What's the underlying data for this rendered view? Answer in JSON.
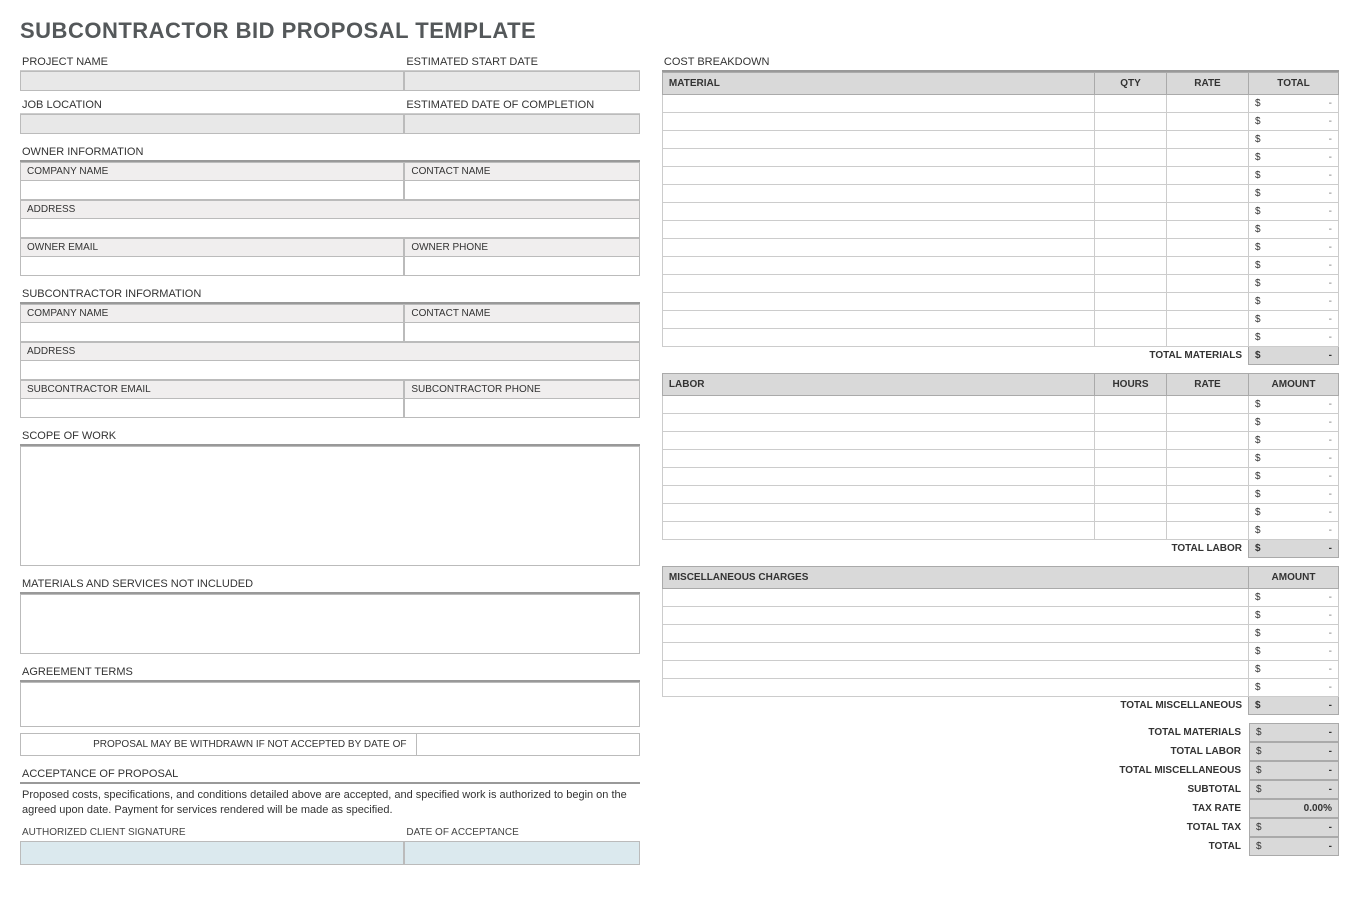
{
  "title": "SUBCONTRACTOR BID PROPOSAL TEMPLATE",
  "left": {
    "project": {
      "project_name_label": "PROJECT NAME",
      "estimated_start_label": "ESTIMATED START DATE",
      "job_location_label": "JOB LOCATION",
      "estimated_completion_label": "ESTIMATED DATE OF COMPLETION"
    },
    "owner": {
      "section": "OWNER INFORMATION",
      "company_label": "COMPANY NAME",
      "contact_label": "CONTACT NAME",
      "address_label": "ADDRESS",
      "email_label": "OWNER EMAIL",
      "phone_label": "OWNER PHONE"
    },
    "sub": {
      "section": "SUBCONTRACTOR INFORMATION",
      "company_label": "COMPANY NAME",
      "contact_label": "CONTACT NAME",
      "address_label": "ADDRESS",
      "email_label": "SUBCONTRACTOR EMAIL",
      "phone_label": "SUBCONTRACTOR PHONE"
    },
    "scope_label": "SCOPE OF WORK",
    "not_included_label": "MATERIALS AND SERVICES NOT INCLUDED",
    "agreement_label": "AGREEMENT TERMS",
    "withdraw_label": "PROPOSAL MAY BE WITHDRAWN IF NOT ACCEPTED BY DATE OF",
    "acceptance_header": "ACCEPTANCE OF PROPOSAL",
    "acceptance_text": "Proposed costs, specifications, and conditions detailed above are accepted, and specified work is authorized to begin on the agreed upon date.  Payment for services rendered will be made as specified.",
    "sig_label": "AUTHORIZED CLIENT SIGNATURE",
    "date_accept_label": "DATE OF ACCEPTANCE"
  },
  "right": {
    "cost_breakdown_label": "COST BREAKDOWN",
    "material": {
      "hdr_material": "MATERIAL",
      "hdr_qty": "QTY",
      "hdr_rate": "RATE",
      "hdr_total": "TOTAL",
      "row_count": 14,
      "currency": "$",
      "dash": "-",
      "subtotal_label": "TOTAL MATERIALS"
    },
    "labor": {
      "hdr_labor": "LABOR",
      "hdr_hours": "HOURS",
      "hdr_rate": "RATE",
      "hdr_amount": "AMOUNT",
      "row_count": 8,
      "currency": "$",
      "dash": "-",
      "subtotal_label": "TOTAL LABOR"
    },
    "misc": {
      "hdr_misc": "MISCELLANEOUS CHARGES",
      "hdr_amount": "AMOUNT",
      "row_count": 6,
      "currency": "$",
      "dash": "-",
      "subtotal_label": "TOTAL MISCELLANEOUS"
    },
    "totals": {
      "rows": [
        {
          "label": "TOTAL MATERIALS",
          "sym": "$",
          "val": "-"
        },
        {
          "label": "TOTAL LABOR",
          "sym": "$",
          "val": "-"
        },
        {
          "label": "TOTAL MISCELLANEOUS",
          "sym": "$",
          "val": "-"
        },
        {
          "label": "SUBTOTAL",
          "sym": "$",
          "val": "-"
        },
        {
          "label": "TAX RATE",
          "pct": "0.00%"
        },
        {
          "label": "TOTAL TAX",
          "sym": "$",
          "val": "-"
        },
        {
          "label": "TOTAL",
          "sym": "$",
          "val": "-"
        }
      ]
    }
  }
}
